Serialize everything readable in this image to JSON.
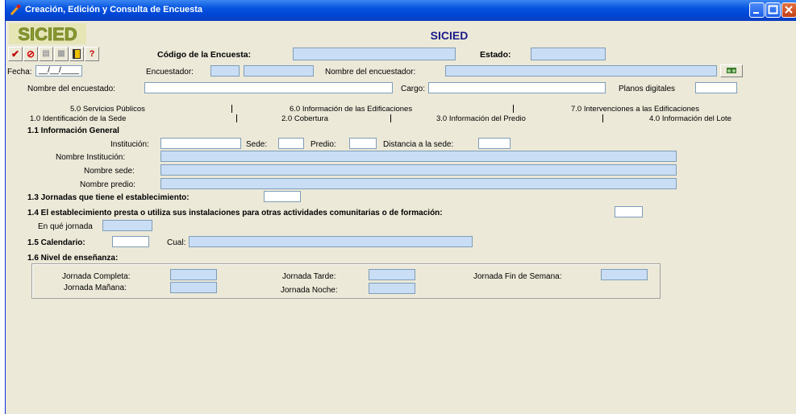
{
  "window": {
    "title": "Creación, Edición y Consulta de Encuesta"
  },
  "app": {
    "title": "SICIED",
    "logo_text": "SICIED"
  },
  "toolbar": {
    "help_label": "?",
    "codigo_label": "Código de la Encuesta:",
    "estado_label": "Estado:"
  },
  "row1": {
    "fecha_label": "Fecha:",
    "fecha_value": "__/__/____",
    "encuestador_label": "Encuestador:",
    "nombre_encuestador_label": "Nombre del encuestador:"
  },
  "row2": {
    "nombre_encuestado_label": "Nombre del encuestado:",
    "cargo_label": "Cargo:",
    "planos_label": "Planos digitales"
  },
  "tabs_top": [
    "5.0 Servicios Públicos",
    "6.0 Información de las Edificaciones",
    "7.0 Intervenciones a las Edificaciones"
  ],
  "tabs_bottom": [
    "1.0 Identificación de la Sede",
    "2.0 Cobertura",
    "3.0 Información del Predio",
    "4.0 Información del Lote"
  ],
  "section_1_1": {
    "title": "1.1 Información General",
    "institucion_label": "Institución:",
    "sede_label": "Sede:",
    "predio_label": "Predio:",
    "distancia_label": "Distancia a la sede:",
    "nombre_institucion_label": "Nombre Institución:",
    "nombre_sede_label": "Nombre sede:",
    "nombre_predio_label": "Nombre predio:"
  },
  "section_1_3": {
    "title": "1.3 Jornadas que tiene el establecimiento:"
  },
  "section_1_4": {
    "title": "1.4 El establecimiento presta o utiliza sus instalaciones para otras actividades comunitarias o de formación:",
    "jornada_label": "En qué jornada"
  },
  "section_1_5": {
    "title": "1.5 Calendario:",
    "cual_label": "Cual:"
  },
  "section_1_6": {
    "title": "1.6 Nivel de enseñanza:",
    "completa_label": "Jornada Completa:",
    "manana_label": "Jornada Mañana:",
    "tarde_label": "Jornada Tarde:",
    "noche_label": "Jornada Noche:",
    "fin_semana_label": "Jornada Fin de Semana:"
  }
}
